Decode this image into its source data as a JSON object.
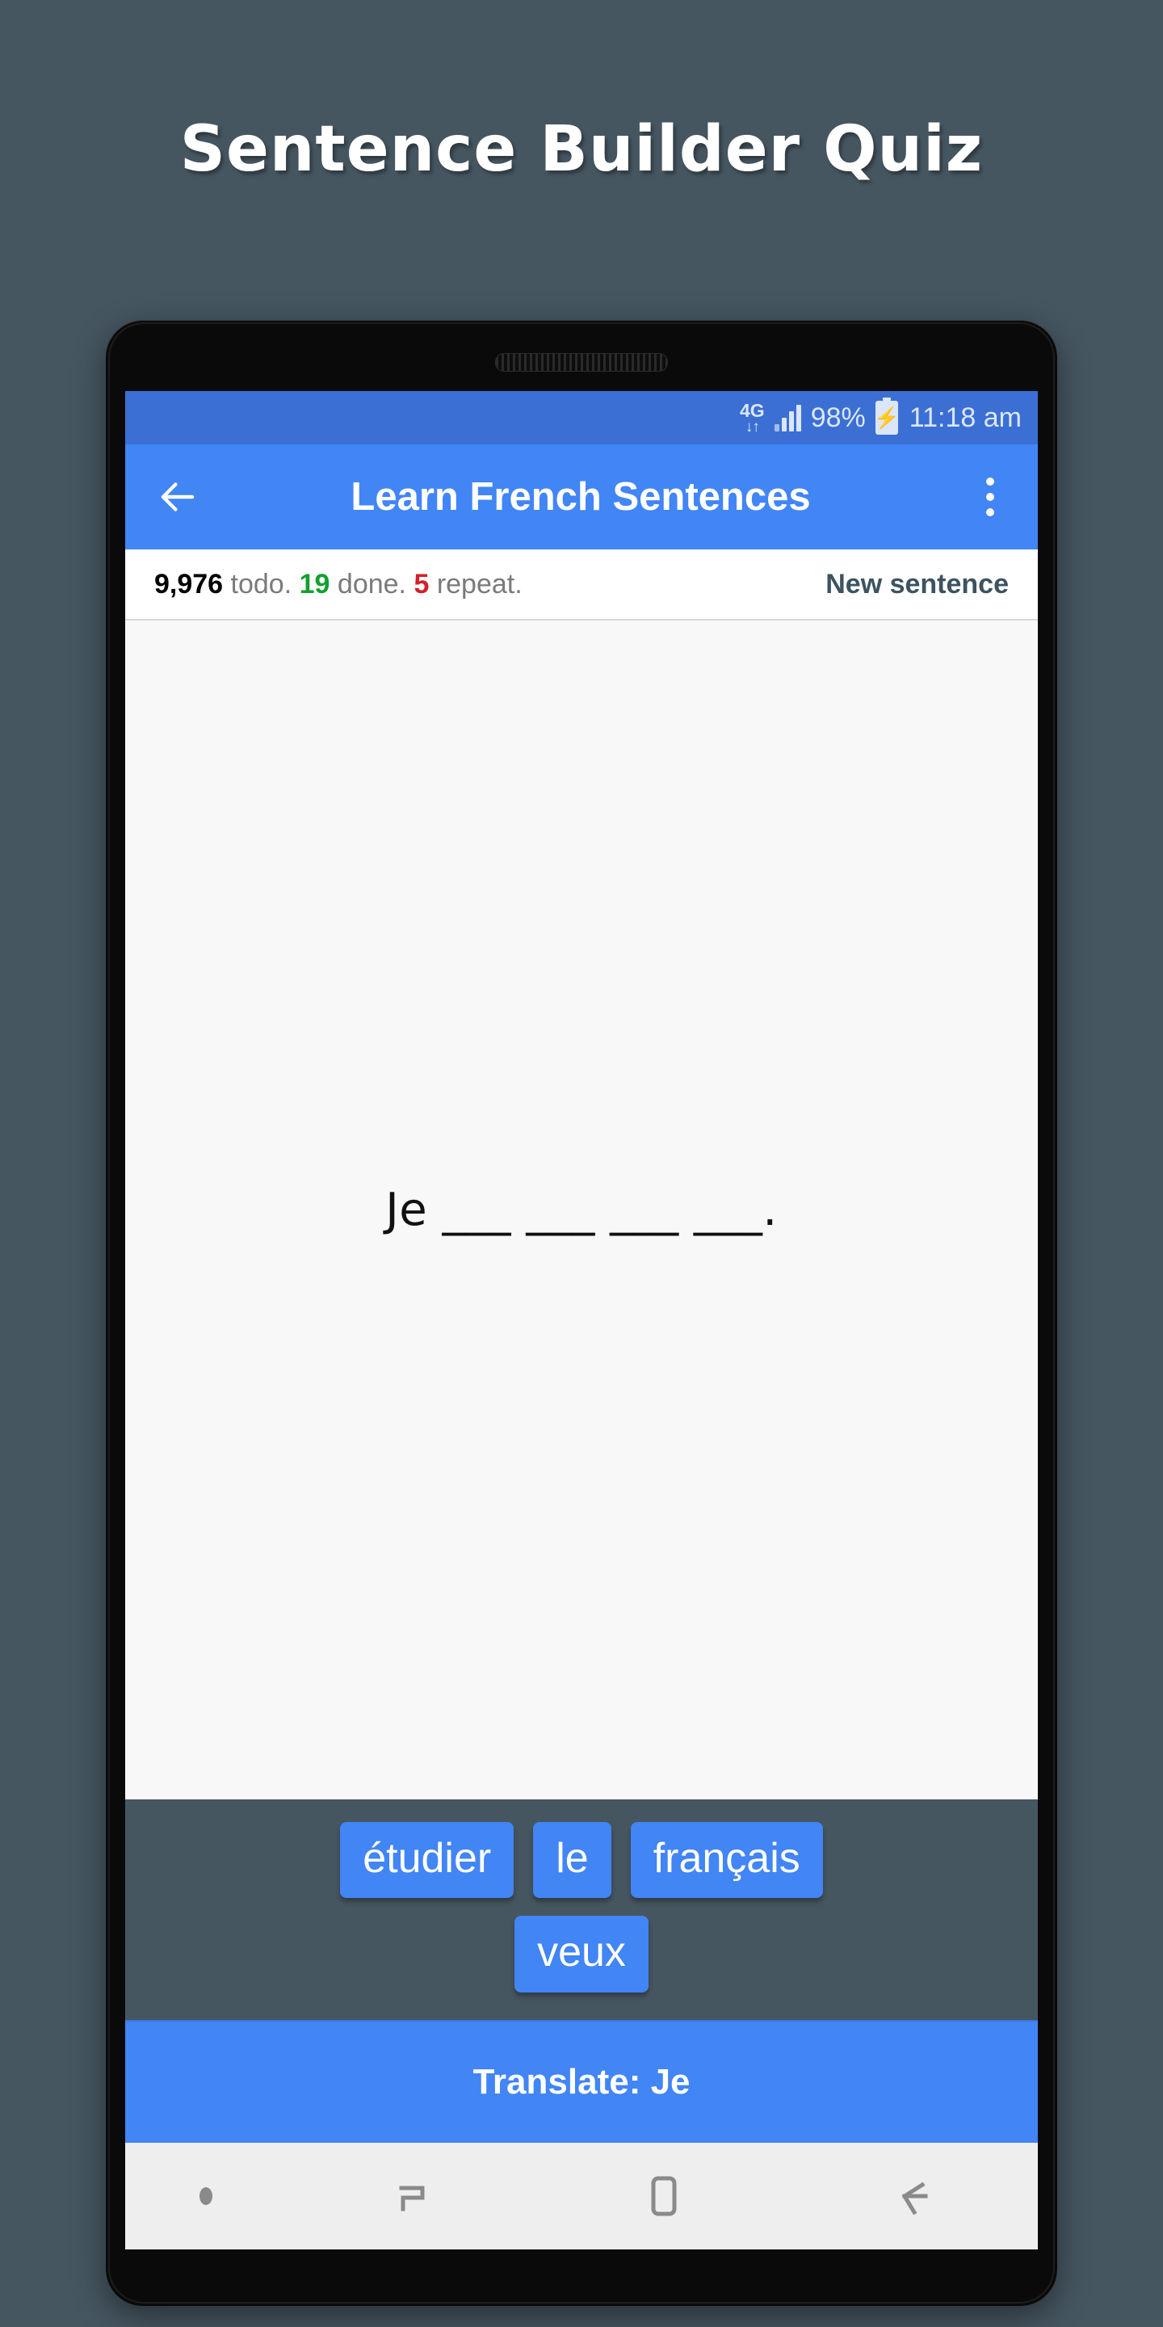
{
  "page": {
    "title": "Sentence Builder Quiz",
    "background_color": "#465661",
    "accent_color": "#4285f4"
  },
  "device": {
    "status_bar": {
      "network_type": "4G",
      "network_arrows": "↓↑",
      "battery_percent": "98%",
      "battery_icon": "charging-bolt",
      "time": "11:18 am",
      "signal_icon": "signal-bars",
      "background_color": "#3b6fd4"
    }
  },
  "app_bar": {
    "back_icon": "arrow-left-icon",
    "title": "Learn French Sentences",
    "overflow_icon": "more-vertical-icon",
    "background_color": "#4285f4"
  },
  "stats": {
    "todo_count": "9,976",
    "todo_label": "todo.",
    "done_count": "19",
    "done_label": "done.",
    "repeat_count": "5",
    "repeat_label": "repeat.",
    "new_sentence_label": "New sentence",
    "done_color": "#12a030",
    "repeat_color": "#d3202a"
  },
  "sentence": {
    "prompt": "Je ___ ___ ___ ___."
  },
  "word_bank": {
    "rows": [
      [
        "étudier",
        "le",
        "français"
      ],
      [
        "veux"
      ]
    ]
  },
  "translate_bar": {
    "label": "Translate: Je"
  },
  "nav_bar": {
    "items": [
      {
        "icon": "notification-dot-icon",
        "label": ""
      },
      {
        "icon": "recents-icon",
        "label": ""
      },
      {
        "icon": "home-icon",
        "label": ""
      },
      {
        "icon": "back-icon",
        "label": ""
      }
    ]
  }
}
